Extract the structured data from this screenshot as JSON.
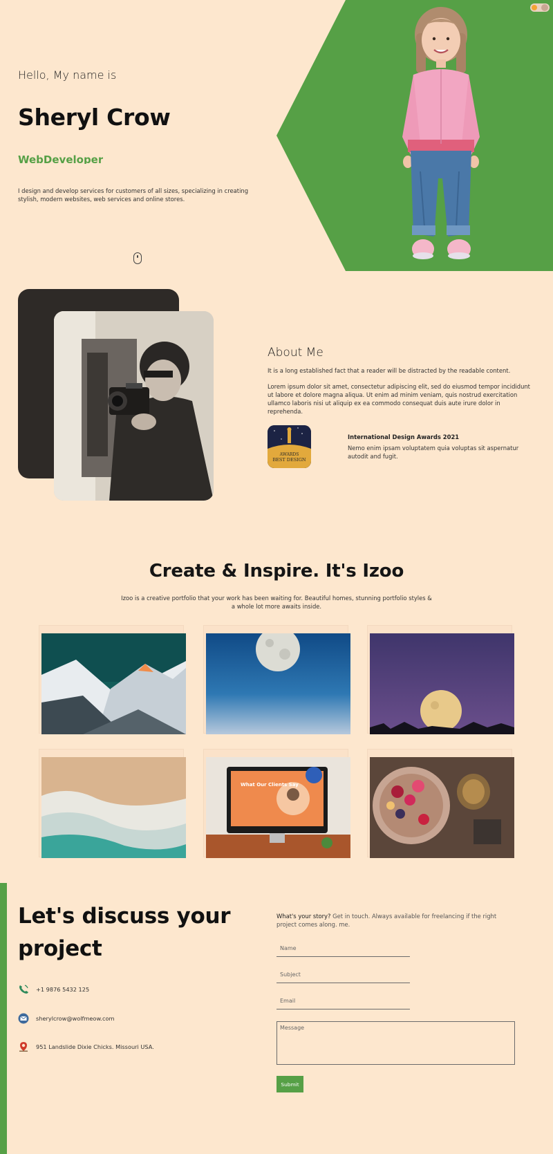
{
  "hero": {
    "greeting": "Hello, My name is",
    "name": "Sheryl Crow",
    "role": "WebDeveloper",
    "description": "I design and develop services for customers of all sizes, specializing in creating stylish, modern websites, web services and online stores.",
    "accent_color": "#56a046"
  },
  "about": {
    "title": "About Me",
    "lead": "It is a long established fact that a reader will be distracted by the readable content.",
    "body": "Lorem ipsum dolor sit amet, consectetur adipiscing elit, sed do eiusmod tempor incididunt ut labore et dolore magna aliqua. Ut enim ad minim veniam, quis nostrud exercitation ullamco laboris nisi ut aliquip ex ea commodo consequat duis aute irure dolor in reprehenda.",
    "award": {
      "badge_line1": "AWARDS",
      "badge_line2": "BEST DESIGN",
      "title": "International Design Awards 2021",
      "text": "Nemo enim ipsam voluptatem quia voluptas sit aspernatur autodit and fugit."
    }
  },
  "portfolio": {
    "title": "Create & Inspire. It's Izoo",
    "description": "Izoo is a creative portfolio that your work has been waiting for. Beautiful homes, stunning portfolio styles & a whole lot more awaits inside.",
    "items": [
      "mountains",
      "moon-blue-sky",
      "moon-purple-sky",
      "ocean-waves",
      "desk-computer",
      "fruit-bowl"
    ],
    "screen_text": "What Our Clients Say"
  },
  "contact": {
    "title": "Let's discuss your project",
    "phone": "+1 9876 5432 125",
    "email": "sherylcrow@wolfmeow.com",
    "address": "951 Landslide Dixie Chicks. Missouri USA.",
    "story_lead": "What's your story?",
    "story_rest": " Get in touch. Always available for freelancing if the right project comes along. me.",
    "name_placeholder": "Name",
    "subject_placeholder": "Subject",
    "email_placeholder": "Email",
    "message_placeholder": "Message",
    "submit_label": "Submit"
  }
}
